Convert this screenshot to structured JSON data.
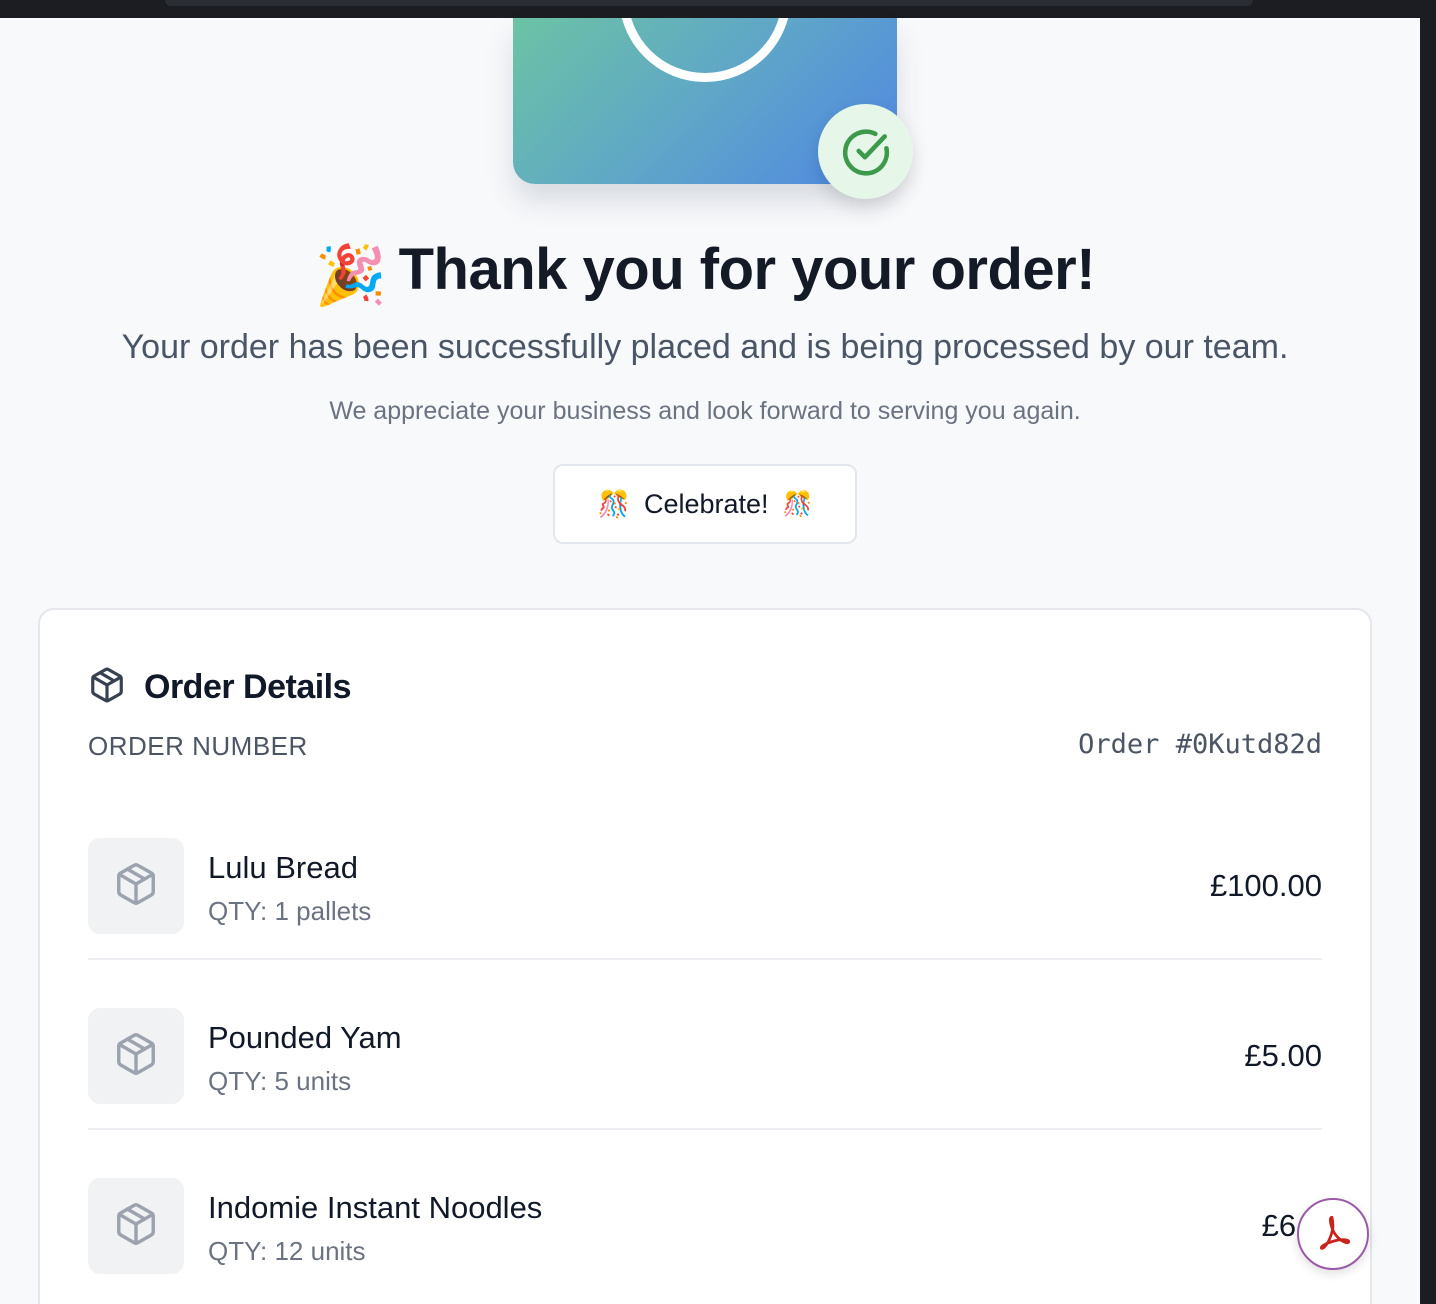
{
  "hero": {
    "badge_icon": "check-circle-icon",
    "accent_color": "#3d9a4b"
  },
  "heading": {
    "emoji": "🎉",
    "title": "Thank you for your order!"
  },
  "messages": {
    "primary": "Your order has been successfully placed and is being processed by our team.",
    "secondary": "We appreciate your business and look forward to serving you again."
  },
  "celebrate_button": {
    "left_emoji": "🎊",
    "label": "Celebrate!",
    "right_emoji": "🎊"
  },
  "order_details": {
    "title": "Order Details",
    "order_number_label": "ORDER NUMBER",
    "order_number_value": "Order #0Kutd82d",
    "items": [
      {
        "name": "Lulu Bread",
        "qty": "QTY: 1 pallets",
        "price": "£100.00"
      },
      {
        "name": "Pounded Yam",
        "qty": "QTY: 5 units",
        "price": "£5.00"
      },
      {
        "name": "Indomie Instant Noodles",
        "qty": "QTY: 12 units",
        "price": "£6.6"
      }
    ]
  }
}
